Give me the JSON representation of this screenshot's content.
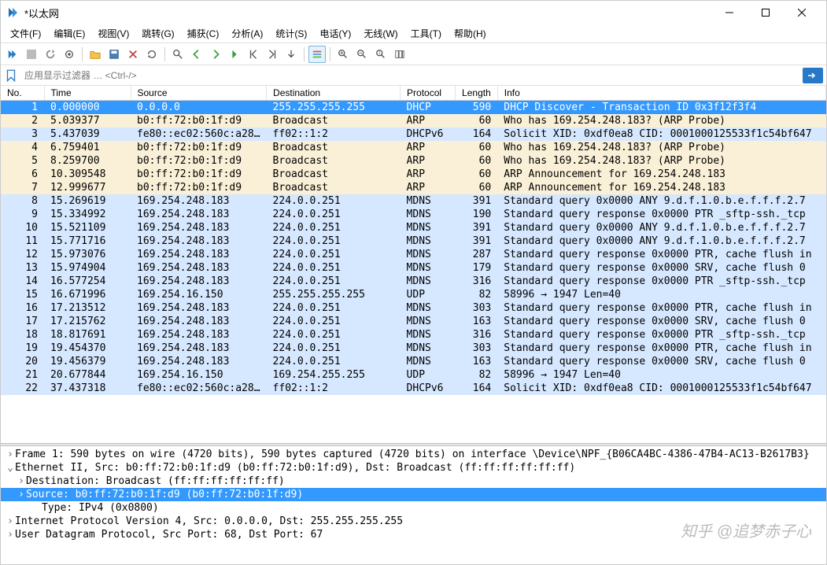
{
  "window": {
    "title": "*以太网"
  },
  "menu": {
    "file": "文件(F)",
    "edit": "编辑(E)",
    "view": "视图(V)",
    "go": "跳转(G)",
    "capture": "捕获(C)",
    "analyze": "分析(A)",
    "statistics": "统计(S)",
    "telephony": "电话(Y)",
    "wireless": "无线(W)",
    "tools": "工具(T)",
    "help": "帮助(H)"
  },
  "filter": {
    "placeholder": "应用显示过滤器 … <Ctrl-/>"
  },
  "cols": {
    "no": "No.",
    "time": "Time",
    "source": "Source",
    "destination": "Destination",
    "protocol": "Protocol",
    "length": "Length",
    "info": "Info"
  },
  "packets": [
    {
      "no": 1,
      "time": "0.000000",
      "src": "0.0.0.0",
      "dst": "255.255.255.255",
      "proto": "DHCP",
      "len": 590,
      "info": "DHCP Discover - Transaction ID 0x3f12f3f4",
      "cls": "selected"
    },
    {
      "no": 2,
      "time": "5.039377",
      "src": "b0:ff:72:b0:1f:d9",
      "dst": "Broadcast",
      "proto": "ARP",
      "len": 60,
      "info": "Who has 169.254.248.183? (ARP Probe)",
      "cls": "arp"
    },
    {
      "no": 3,
      "time": "5.437039",
      "src": "fe80::ec02:560c:a28…",
      "dst": "ff02::1:2",
      "proto": "DHCPv6",
      "len": 164,
      "info": "Solicit XID: 0xdf0ea8 CID: 0001000125533f1c54bf647",
      "cls": "dhcpv6"
    },
    {
      "no": 4,
      "time": "6.759401",
      "src": "b0:ff:72:b0:1f:d9",
      "dst": "Broadcast",
      "proto": "ARP",
      "len": 60,
      "info": "Who has 169.254.248.183? (ARP Probe)",
      "cls": "arp"
    },
    {
      "no": 5,
      "time": "8.259700",
      "src": "b0:ff:72:b0:1f:d9",
      "dst": "Broadcast",
      "proto": "ARP",
      "len": 60,
      "info": "Who has 169.254.248.183? (ARP Probe)",
      "cls": "arp"
    },
    {
      "no": 6,
      "time": "10.309548",
      "src": "b0:ff:72:b0:1f:d9",
      "dst": "Broadcast",
      "proto": "ARP",
      "len": 60,
      "info": "ARP Announcement for 169.254.248.183",
      "cls": "arp"
    },
    {
      "no": 7,
      "time": "12.999677",
      "src": "b0:ff:72:b0:1f:d9",
      "dst": "Broadcast",
      "proto": "ARP",
      "len": 60,
      "info": "ARP Announcement for 169.254.248.183",
      "cls": "arp"
    },
    {
      "no": 8,
      "time": "15.269619",
      "src": "169.254.248.183",
      "dst": "224.0.0.251",
      "proto": "MDNS",
      "len": 391,
      "info": "Standard query 0x0000 ANY 9.d.f.1.0.b.e.f.f.f.2.7",
      "cls": "mdns"
    },
    {
      "no": 9,
      "time": "15.334992",
      "src": "169.254.248.183",
      "dst": "224.0.0.251",
      "proto": "MDNS",
      "len": 190,
      "info": "Standard query response 0x0000 PTR _sftp-ssh._tcp",
      "cls": "mdns"
    },
    {
      "no": 10,
      "time": "15.521109",
      "src": "169.254.248.183",
      "dst": "224.0.0.251",
      "proto": "MDNS",
      "len": 391,
      "info": "Standard query 0x0000 ANY 9.d.f.1.0.b.e.f.f.f.2.7",
      "cls": "mdns"
    },
    {
      "no": 11,
      "time": "15.771716",
      "src": "169.254.248.183",
      "dst": "224.0.0.251",
      "proto": "MDNS",
      "len": 391,
      "info": "Standard query 0x0000 ANY 9.d.f.1.0.b.e.f.f.f.2.7",
      "cls": "mdns"
    },
    {
      "no": 12,
      "time": "15.973076",
      "src": "169.254.248.183",
      "dst": "224.0.0.251",
      "proto": "MDNS",
      "len": 287,
      "info": "Standard query response 0x0000 PTR, cache flush in",
      "cls": "mdns"
    },
    {
      "no": 13,
      "time": "15.974904",
      "src": "169.254.248.183",
      "dst": "224.0.0.251",
      "proto": "MDNS",
      "len": 179,
      "info": "Standard query response 0x0000 SRV, cache flush 0",
      "cls": "mdns"
    },
    {
      "no": 14,
      "time": "16.577254",
      "src": "169.254.248.183",
      "dst": "224.0.0.251",
      "proto": "MDNS",
      "len": 316,
      "info": "Standard query response 0x0000 PTR _sftp-ssh._tcp",
      "cls": "mdns"
    },
    {
      "no": 15,
      "time": "16.671996",
      "src": "169.254.16.150",
      "dst": "255.255.255.255",
      "proto": "UDP",
      "len": 82,
      "info": "58996 → 1947 Len=40",
      "cls": "udp"
    },
    {
      "no": 16,
      "time": "17.213512",
      "src": "169.254.248.183",
      "dst": "224.0.0.251",
      "proto": "MDNS",
      "len": 303,
      "info": "Standard query response 0x0000 PTR, cache flush in",
      "cls": "mdns"
    },
    {
      "no": 17,
      "time": "17.215762",
      "src": "169.254.248.183",
      "dst": "224.0.0.251",
      "proto": "MDNS",
      "len": 163,
      "info": "Standard query response 0x0000 SRV, cache flush 0",
      "cls": "mdns"
    },
    {
      "no": 18,
      "time": "18.817691",
      "src": "169.254.248.183",
      "dst": "224.0.0.251",
      "proto": "MDNS",
      "len": 316,
      "info": "Standard query response 0x0000 PTR _sftp-ssh._tcp",
      "cls": "mdns"
    },
    {
      "no": 19,
      "time": "19.454370",
      "src": "169.254.248.183",
      "dst": "224.0.0.251",
      "proto": "MDNS",
      "len": 303,
      "info": "Standard query response 0x0000 PTR, cache flush in",
      "cls": "mdns"
    },
    {
      "no": 20,
      "time": "19.456379",
      "src": "169.254.248.183",
      "dst": "224.0.0.251",
      "proto": "MDNS",
      "len": 163,
      "info": "Standard query response 0x0000 SRV, cache flush 0",
      "cls": "mdns"
    },
    {
      "no": 21,
      "time": "20.677844",
      "src": "169.254.16.150",
      "dst": "169.254.255.255",
      "proto": "UDP",
      "len": 82,
      "info": "58996 → 1947 Len=40",
      "cls": "udp"
    },
    {
      "no": 22,
      "time": "37.437318",
      "src": "fe80::ec02:560c:a28…",
      "dst": "ff02::1:2",
      "proto": "DHCPv6",
      "len": 164,
      "info": "Solicit XID: 0xdf0ea8 CID: 0001000125533f1c54bf647",
      "cls": "dhcpv6"
    }
  ],
  "details": {
    "frame": "Frame 1: 590 bytes on wire (4720 bits), 590 bytes captured (4720 bits) on interface \\Device\\NPF_{B06CA4BC-4386-47B4-AC13-B2617B3}",
    "eth": "Ethernet II, Src: b0:ff:72:b0:1f:d9 (b0:ff:72:b0:1f:d9), Dst: Broadcast (ff:ff:ff:ff:ff:ff)",
    "eth_dst": "Destination: Broadcast (ff:ff:ff:ff:ff:ff)",
    "eth_src": "Source: b0:ff:72:b0:1f:d9 (b0:ff:72:b0:1f:d9)",
    "eth_type": "Type: IPv4 (0x0800)",
    "ip": "Internet Protocol Version 4, Src: 0.0.0.0, Dst: 255.255.255.255",
    "udp": "User Datagram Protocol, Src Port: 68, Dst Port: 67"
  },
  "watermark": "知乎 @追梦赤子心"
}
